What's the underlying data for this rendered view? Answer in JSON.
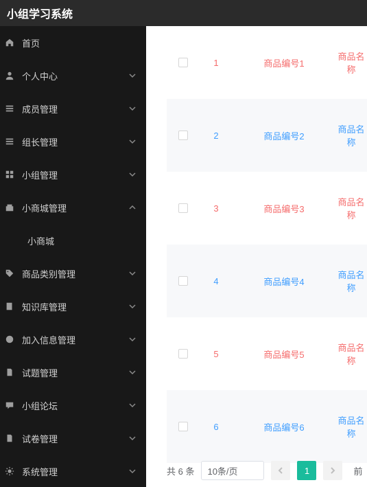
{
  "header": {
    "title": "小组学习系统"
  },
  "sidebar": {
    "items": [
      {
        "key": "home",
        "label": "首页",
        "icon": "home",
        "arrow": ""
      },
      {
        "key": "personal",
        "label": "个人中心",
        "icon": "user",
        "arrow": "down"
      },
      {
        "key": "member",
        "label": "成员管理",
        "icon": "list",
        "arrow": "down"
      },
      {
        "key": "leader",
        "label": "组长管理",
        "icon": "list",
        "arrow": "down"
      },
      {
        "key": "group",
        "label": "小组管理",
        "icon": "grid",
        "arrow": "down"
      },
      {
        "key": "mall-mgr",
        "label": "小商城管理",
        "icon": "shop",
        "arrow": "up"
      },
      {
        "key": "mall",
        "label": "小商城",
        "icon": "",
        "arrow": "",
        "sub": true
      },
      {
        "key": "category",
        "label": "商品类别管理",
        "icon": "tag",
        "arrow": "down"
      },
      {
        "key": "knowledge",
        "label": "知识库管理",
        "icon": "book",
        "arrow": "down"
      },
      {
        "key": "joininfo",
        "label": "加入信息管理",
        "icon": "info",
        "arrow": "down"
      },
      {
        "key": "question",
        "label": "试题管理",
        "icon": "doc",
        "arrow": "down"
      },
      {
        "key": "forum",
        "label": "小组论坛",
        "icon": "chat",
        "arrow": "down"
      },
      {
        "key": "exam",
        "label": "试卷管理",
        "icon": "doc",
        "arrow": "down"
      },
      {
        "key": "system",
        "label": "系统管理",
        "icon": "gear",
        "arrow": "down"
      }
    ]
  },
  "table": {
    "rows": [
      {
        "num": "1",
        "code": "商品编号1",
        "name": "商品名称",
        "color": "red"
      },
      {
        "num": "2",
        "code": "商品编号2",
        "name": "商品名称",
        "color": "blue"
      },
      {
        "num": "3",
        "code": "商品编号3",
        "name": "商品名称",
        "color": "red"
      },
      {
        "num": "4",
        "code": "商品编号4",
        "name": "商品名称",
        "color": "blue"
      },
      {
        "num": "5",
        "code": "商品编号5",
        "name": "商品名称",
        "color": "red"
      },
      {
        "num": "6",
        "code": "商品编号6",
        "name": "商品名称",
        "color": "blue"
      }
    ]
  },
  "pagination": {
    "total": "共 6 条",
    "per_page": "10条/页",
    "current": "1",
    "last_fragment": "前"
  }
}
